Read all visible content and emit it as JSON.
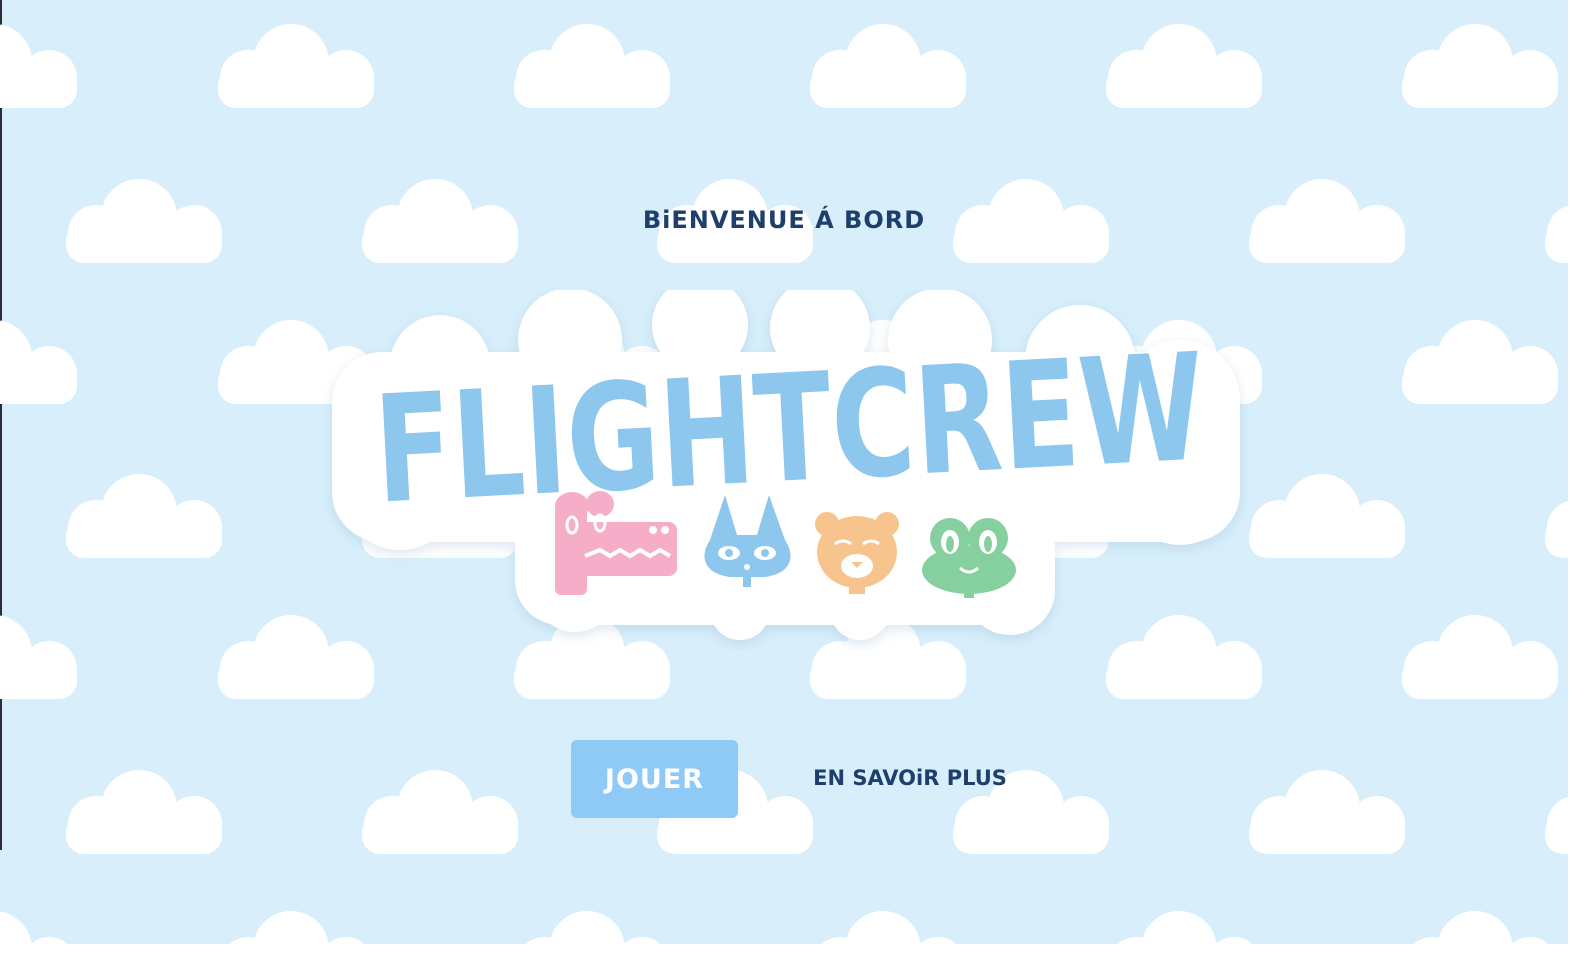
{
  "colors": {
    "sky": "#d8effb",
    "cloud": "#ffffff",
    "logo_letters": "#8ec7ee",
    "heading_text": "#1e3f6b",
    "button_bg": "#8fc9f6",
    "crocodile": "#f6adc8",
    "cat": "#8ec7ee",
    "bear": "#f8c48e",
    "frog": "#86d0a0"
  },
  "header": {
    "welcome": "BiENVENUE Á BORD"
  },
  "logo": {
    "title": "FLIGHTCREW",
    "mascots": [
      "crocodile-icon",
      "cat-icon",
      "bear-icon",
      "frog-icon"
    ]
  },
  "actions": {
    "play_label": "JOUER",
    "learn_more_label": "EN SAVOiR PLUS"
  }
}
